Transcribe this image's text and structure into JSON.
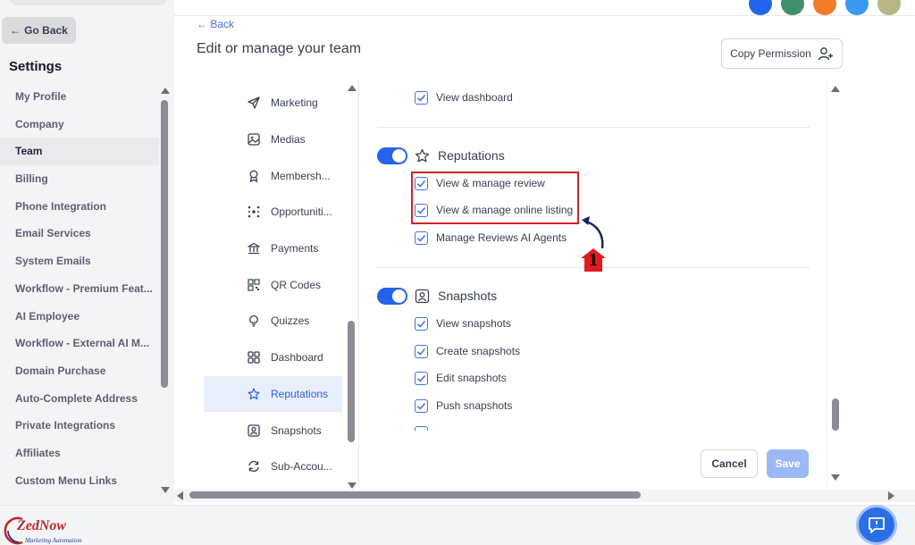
{
  "sidebar": {
    "go_back": "Go Back",
    "title": "Settings",
    "items": [
      {
        "label": "My Profile"
      },
      {
        "label": "Company"
      },
      {
        "label": "Team"
      },
      {
        "label": "Billing"
      },
      {
        "label": "Phone Integration"
      },
      {
        "label": "Email Services"
      },
      {
        "label": "System Emails"
      },
      {
        "label": "Workflow - Premium Feat..."
      },
      {
        "label": "AI Employee"
      },
      {
        "label": "Workflow - External AI M..."
      },
      {
        "label": "Domain Purchase"
      },
      {
        "label": "Auto-Complete Address"
      },
      {
        "label": "Private Integrations"
      },
      {
        "label": "Affiliates"
      },
      {
        "label": "Custom Menu Links"
      }
    ],
    "active": "Team"
  },
  "header": {
    "back": "Back",
    "title": "Edit or manage your team",
    "copy_permission": "Copy Permission"
  },
  "permission_nav": {
    "items": [
      {
        "label": "Marketing",
        "icon": "send-icon"
      },
      {
        "label": "Medias",
        "icon": "image-icon"
      },
      {
        "label": "Membersh...",
        "icon": "award-icon"
      },
      {
        "label": "Opportuniti...",
        "icon": "network-icon"
      },
      {
        "label": "Payments",
        "icon": "bank-icon"
      },
      {
        "label": "QR Codes",
        "icon": "qr-code-icon"
      },
      {
        "label": "Quizzes",
        "icon": "lightbulb-icon"
      },
      {
        "label": "Dashboard",
        "icon": "grid-icon"
      },
      {
        "label": "Reputations",
        "icon": "star-icon"
      },
      {
        "label": "Snapshots",
        "icon": "user-square-icon"
      },
      {
        "label": "Sub-Accou...",
        "icon": "refresh-icon"
      }
    ],
    "active": "Reputations"
  },
  "permissions": {
    "dashboard_item": "View dashboard",
    "reputations": {
      "label": "Reputations",
      "enabled": true,
      "items": [
        "View & manage review",
        "View & manage online listing",
        "Manage Reviews AI Agents"
      ]
    },
    "snapshots": {
      "label": "Snapshots",
      "enabled": true,
      "items": [
        "View snapshots",
        "Create snapshots",
        "Edit snapshots",
        "Push snapshots"
      ]
    }
  },
  "actions": {
    "cancel": "Cancel",
    "save": "Save"
  },
  "annotation": {
    "number": "1"
  },
  "branding": {
    "logo_text": "ZedNow",
    "logo_sub": "Marketing Automation"
  },
  "colors": {
    "accent": "#2463eb",
    "highlight": "#d2232a",
    "save_disabled": "#9bb7f4"
  }
}
